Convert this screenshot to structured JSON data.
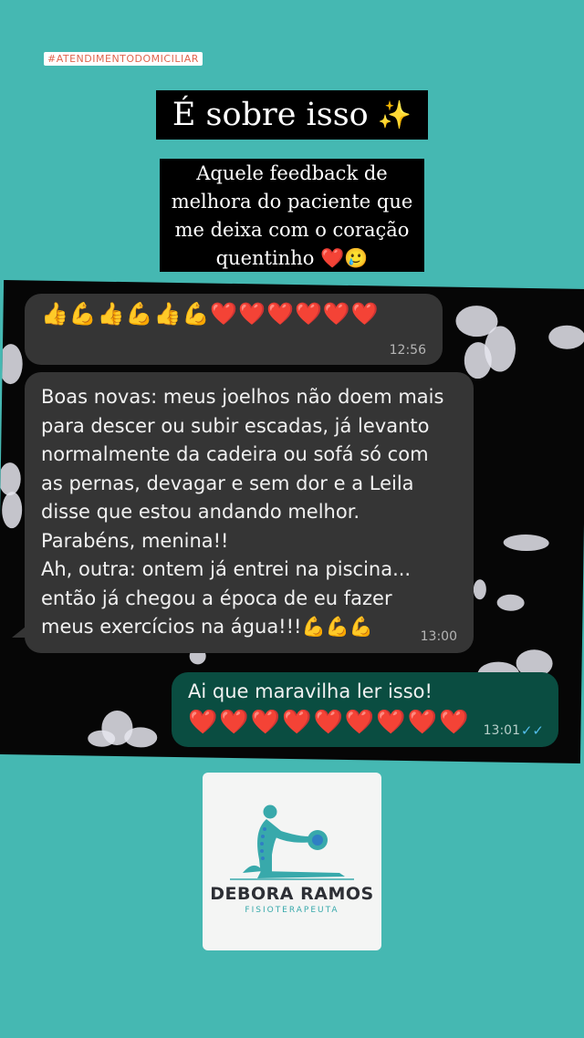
{
  "hashtag": "#ATENDIMENTODOMICILIAR",
  "title": "É sobre isso",
  "title_emoji": "✨",
  "caption": {
    "lines": [
      "Aquele feedback de",
      "melhora do paciente que",
      "me deixa com o coração",
      "quentinho"
    ],
    "end_emojis": "❤️🥲"
  },
  "messages": [
    {
      "direction": "incoming",
      "emojis": [
        "👍",
        "💪",
        "👍",
        "💪",
        "👍",
        "💪",
        "❤️",
        "❤️",
        "❤️",
        "❤️",
        "❤️",
        "❤️"
      ],
      "time": "12:56"
    },
    {
      "direction": "incoming",
      "lines": [
        "Boas novas: meus joelhos não doem mais",
        "para descer ou subir escadas, já levanto",
        "normalmente da cadeira ou sofá só com",
        "as pernas, devagar e sem dor e a Leila",
        "disse que estou andando melhor.",
        "Parabéns, menina!!",
        "Ah, outra: ontem já entrei na piscina...",
        "então já chegou a época de eu fazer",
        "meus exercícios na água!!!💪💪💪"
      ],
      "time": "13:00"
    },
    {
      "direction": "outgoing",
      "text": "Ai que maravilha ler isso!",
      "hearts": "❤️❤️❤️❤️❤️❤️❤️❤️❤️",
      "time": "13:01",
      "status": "read"
    }
  ],
  "logo": {
    "name": "DEBORA RAMOS",
    "subtitle": "FISIOTERAPEUTA"
  },
  "colors": {
    "background": "#45b8b2",
    "incoming_bubble": "#353535",
    "outgoing_bubble": "#0a4d41",
    "read_ticks": "#53bdeb",
    "hashtag_text": "#e0654e"
  }
}
